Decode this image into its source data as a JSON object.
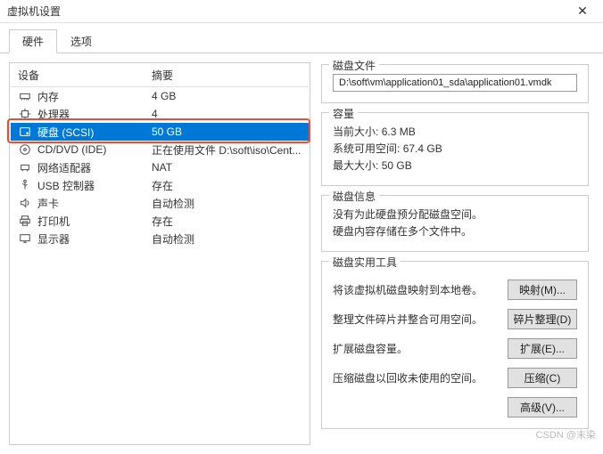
{
  "window": {
    "title": "虚拟机设置"
  },
  "tabs": {
    "hardware": "硬件",
    "options": "选项",
    "active": "hardware"
  },
  "hw_headers": {
    "device": "设备",
    "summary": "摘要"
  },
  "devices": [
    {
      "icon": "memory",
      "label": "内存",
      "summary": "4 GB",
      "selected": false
    },
    {
      "icon": "cpu",
      "label": "处理器",
      "summary": "4",
      "selected": false
    },
    {
      "icon": "disk",
      "label": "硬盘 (SCSI)",
      "summary": "50 GB",
      "selected": true,
      "highlighted": true
    },
    {
      "icon": "cd",
      "label": "CD/DVD (IDE)",
      "summary": "正在使用文件 D:\\soft\\iso\\Cent...",
      "selected": false
    },
    {
      "icon": "net",
      "label": "网络适配器",
      "summary": "NAT",
      "selected": false
    },
    {
      "icon": "usb",
      "label": "USB 控制器",
      "summary": "存在",
      "selected": false
    },
    {
      "icon": "sound",
      "label": "声卡",
      "summary": "自动检测",
      "selected": false
    },
    {
      "icon": "printer",
      "label": "打印机",
      "summary": "存在",
      "selected": false
    },
    {
      "icon": "display",
      "label": "显示器",
      "summary": "自动检测",
      "selected": false
    }
  ],
  "disk_file": {
    "title": "磁盘文件",
    "path": "D:\\soft\\vm\\application01_sda\\application01.vmdk"
  },
  "capacity": {
    "title": "容量",
    "current_label": "当前大小:",
    "current_value": "6.3 MB",
    "free_label": "系统可用空间:",
    "free_value": "67.4 GB",
    "max_label": "最大大小:",
    "max_value": "50 GB"
  },
  "disk_info": {
    "title": "磁盘信息",
    "line1": "没有为此硬盘预分配磁盘空间。",
    "line2": "硬盘内容存储在多个文件中。"
  },
  "utilities": {
    "title": "磁盘实用工具",
    "map_text": "将该虚拟机磁盘映射到本地卷。",
    "map_btn": "映射(M)...",
    "defrag_text": "整理文件碎片并整合可用空间。",
    "defrag_btn": "碎片整理(D)",
    "expand_text": "扩展磁盘容量。",
    "expand_btn": "扩展(E)...",
    "compact_text": "压缩磁盘以回收未使用的空间。",
    "compact_btn": "压缩(C)",
    "advanced_btn": "高级(V)..."
  },
  "watermark": "CSDN @末染"
}
